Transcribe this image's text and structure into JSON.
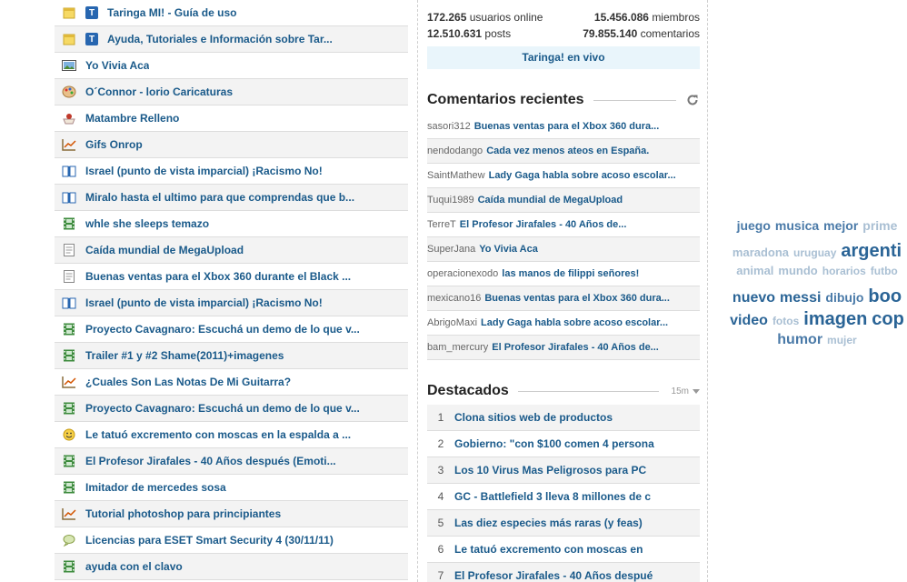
{
  "posts": [
    {
      "icon": "note-icon",
      "badge": "T",
      "title": "Taringa MI! - Guía de uso"
    },
    {
      "icon": "note-icon",
      "badge": "T",
      "title": "Ayuda, Tutoriales e Información sobre Tar..."
    },
    {
      "icon": "image-icon",
      "badge": "",
      "title": "Yo Vivia Aca"
    },
    {
      "icon": "palette-icon",
      "badge": "",
      "title": "O´Connor - lorio Caricaturas"
    },
    {
      "icon": "food-icon",
      "badge": "",
      "title": "Matambre Relleno"
    },
    {
      "icon": "chart-icon",
      "badge": "",
      "title": "Gifs Onrop"
    },
    {
      "icon": "book-icon",
      "badge": "",
      "title": "Israel (punto de vista imparcial) ¡Racismo No!"
    },
    {
      "icon": "book-icon",
      "badge": "",
      "title": "Miralo hasta el ultimo para que comprendas que b..."
    },
    {
      "icon": "film-icon",
      "badge": "",
      "title": "whle she sleeps temazo"
    },
    {
      "icon": "document-icon",
      "badge": "",
      "title": "Caída mundial de MegaUpload"
    },
    {
      "icon": "document-icon",
      "badge": "",
      "title": "Buenas ventas para el Xbox 360 durante el Black ..."
    },
    {
      "icon": "book-icon",
      "badge": "",
      "title": "Israel (punto de vista imparcial) ¡Racismo No!"
    },
    {
      "icon": "film-icon",
      "badge": "",
      "title": "Proyecto Cavagnaro: Escuchá un demo de lo que v..."
    },
    {
      "icon": "film-icon",
      "badge": "",
      "title": "Trailer #1 y #2 Shame(2011)+imagenes"
    },
    {
      "icon": "chart-icon",
      "badge": "",
      "title": "¿Cuales Son Las Notas De Mi Guitarra?"
    },
    {
      "icon": "film-icon",
      "badge": "",
      "title": "Proyecto Cavagnaro: Escuchá un demo de lo que v..."
    },
    {
      "icon": "smiley-icon",
      "badge": "",
      "title": "Le tatuó excremento con moscas en la espalda a ..."
    },
    {
      "icon": "film-icon",
      "badge": "",
      "title": "El Profesor Jirafales - 40 Años después (Emoti..."
    },
    {
      "icon": "film-icon",
      "badge": "",
      "title": "Imitador de mercedes sosa"
    },
    {
      "icon": "chart-icon",
      "badge": "",
      "title": "Tutorial photoshop para principiantes"
    },
    {
      "icon": "chat-icon",
      "badge": "",
      "title": "Licencias para ESET Smart Security 4 (30/11/11)"
    },
    {
      "icon": "film-icon",
      "badge": "",
      "title": "ayuda con el clavo"
    }
  ],
  "stats": {
    "users_online": "172.265",
    "users_online_label": "usuarios online",
    "members": "15.456.086",
    "members_label": "miembros",
    "posts": "12.510.631",
    "posts_label": "posts",
    "comments": "79.855.140",
    "comments_label": "comentarios"
  },
  "live_label": "Taringa! en vivo",
  "recent_comments": {
    "title": "Comentarios recientes",
    "items": [
      {
        "user": "sasori312",
        "post": "Buenas ventas para el Xbox 360 dura..."
      },
      {
        "user": "nendodango",
        "post": "Cada vez menos ateos en España."
      },
      {
        "user": "SaintMathew",
        "post": "Lady Gaga habla sobre acoso escolar..."
      },
      {
        "user": "Tuqui1989",
        "post": "Caída mundial de MegaUpload"
      },
      {
        "user": "TerreT",
        "post": "El Profesor Jirafales - 40 Años de..."
      },
      {
        "user": "SuperJana",
        "post": "Yo Vivia Aca"
      },
      {
        "user": "operacionexodo",
        "post": "las manos de filippi señores!"
      },
      {
        "user": "mexicano16",
        "post": "Buenas ventas para el Xbox 360 dura..."
      },
      {
        "user": "AbrigoMaxi",
        "post": "Lady Gaga habla sobre acoso escolar..."
      },
      {
        "user": "bam_mercury",
        "post": "El Profesor Jirafales - 40 Años de..."
      }
    ]
  },
  "featured": {
    "title": "Destacados",
    "interval": "15m",
    "items": [
      {
        "num": "1",
        "title": "Clona sitios web de productos"
      },
      {
        "num": "2",
        "title": "Gobierno: \"con $100 comen 4 persona"
      },
      {
        "num": "3",
        "title": "Los 10 Virus Mas Peligrosos para PC"
      },
      {
        "num": "4",
        "title": "GC - Battlefield 3 lleva 8 millones de c"
      },
      {
        "num": "5",
        "title": "Las diez especies más raras (y feas)"
      },
      {
        "num": "6",
        "title": "Le tatuó excremento con moscas en"
      },
      {
        "num": "7",
        "title": "El Profesor Jirafales - 40 Años despué"
      }
    ]
  },
  "tag_cloud": [
    [
      {
        "text": "juego",
        "size": 14,
        "color": "#4a7aa8"
      },
      {
        "text": "musica",
        "size": 14,
        "color": "#4a7aa8"
      },
      {
        "text": "mejor",
        "size": 14,
        "color": "#4a7aa8"
      },
      {
        "text": "prime",
        "size": 14,
        "color": "#a9bfd3"
      }
    ],
    [
      {
        "text": "maradona",
        "size": 13,
        "color": "#a9bfd3"
      },
      {
        "text": "uruguay",
        "size": 12,
        "color": "#a9bfd3"
      },
      {
        "text": "argenti",
        "size": 20,
        "color": "#2a6496"
      }
    ],
    [
      {
        "text": "animal",
        "size": 13,
        "color": "#a9bfd3"
      },
      {
        "text": "mundo",
        "size": 13,
        "color": "#a9bfd3"
      },
      {
        "text": "horarios",
        "size": 12,
        "color": "#a9bfd3"
      },
      {
        "text": "futbo",
        "size": 12,
        "color": "#a9bfd3"
      }
    ],
    [
      {
        "text": "nuevo",
        "size": 16,
        "color": "#2a6496"
      },
      {
        "text": "messi",
        "size": 16,
        "color": "#2a6496"
      },
      {
        "text": "dibujo",
        "size": 14,
        "color": "#4a7aa8"
      },
      {
        "text": "boo",
        "size": 20,
        "color": "#2a6496"
      }
    ],
    [
      {
        "text": "video",
        "size": 16,
        "color": "#2a6496"
      },
      {
        "text": "fotos",
        "size": 12,
        "color": "#a9bfd3"
      },
      {
        "text": "imagen",
        "size": 20,
        "color": "#2a6496"
      },
      {
        "text": "cop",
        "size": 20,
        "color": "#2a6496"
      }
    ],
    [
      {
        "text": "humor",
        "size": 16,
        "color": "#4a7aa8"
      },
      {
        "text": "mujer",
        "size": 12,
        "color": "#a9bfd3"
      }
    ]
  ]
}
